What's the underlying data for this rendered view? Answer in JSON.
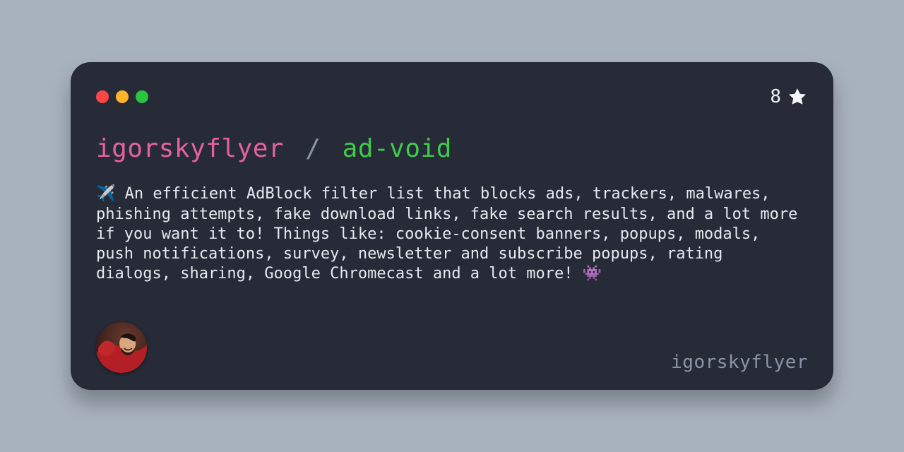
{
  "card": {
    "owner": "igorskyflyer",
    "separator": "/",
    "repo": "ad-void",
    "description": "✈️ An efficient AdBlock filter list that blocks ads, trackers, malwares, phishing attempts, fake download links, fake search results, and a lot more if you want it to! Things like: cookie-consent banners, popups, modals, push notifications, survey, newsletter and subscribe popups, rating dialogs, sharing, Google Chromecast and a lot more! 👾",
    "stars": "8",
    "username": "igorskyflyer"
  },
  "colors": {
    "owner": "#e362a0",
    "repo": "#3fcb4b",
    "card_bg": "#272b38",
    "page_bg": "#a8b2bd"
  },
  "icons": {
    "star": "star-icon",
    "traffic_red": "traffic-light-red",
    "traffic_yellow": "traffic-light-yellow",
    "traffic_green": "traffic-light-green",
    "avatar": "user-avatar"
  }
}
